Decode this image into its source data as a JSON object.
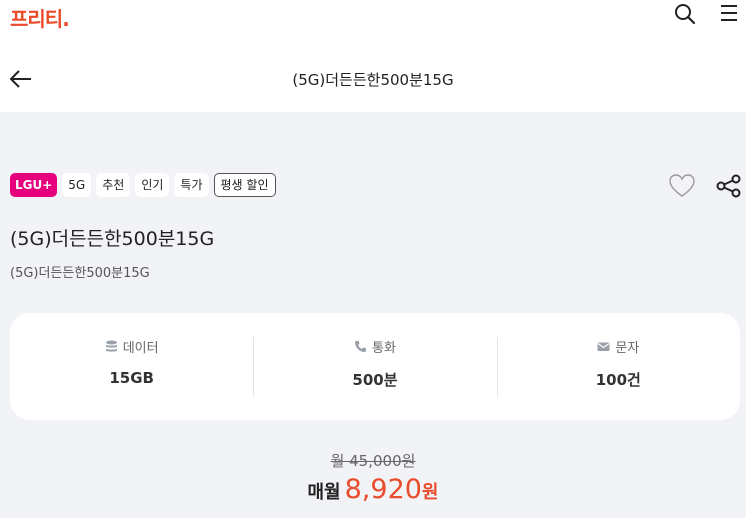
{
  "header": {
    "logo": "프리티.",
    "page_title": "(5G)더든든한500분15G"
  },
  "plan": {
    "badges": [
      "LGU+",
      "5G",
      "추천",
      "인기",
      "특가",
      "평생 할인"
    ],
    "name": "(5G)더든든한500분15G",
    "subtitle": "(5G)더든든한500분15G"
  },
  "specs": [
    {
      "icon": "database-icon",
      "label": "데이터",
      "value": "15GB"
    },
    {
      "icon": "phone-icon",
      "label": "통화",
      "value": "500분"
    },
    {
      "icon": "mail-icon",
      "label": "문자",
      "value": "100건"
    }
  ],
  "price": {
    "original": "월 45,000원",
    "prefix": "매월",
    "amount": "8,920",
    "unit": "원"
  },
  "colors": {
    "brand": "#ea4b2b",
    "carrier_badge": "#e6007e"
  }
}
